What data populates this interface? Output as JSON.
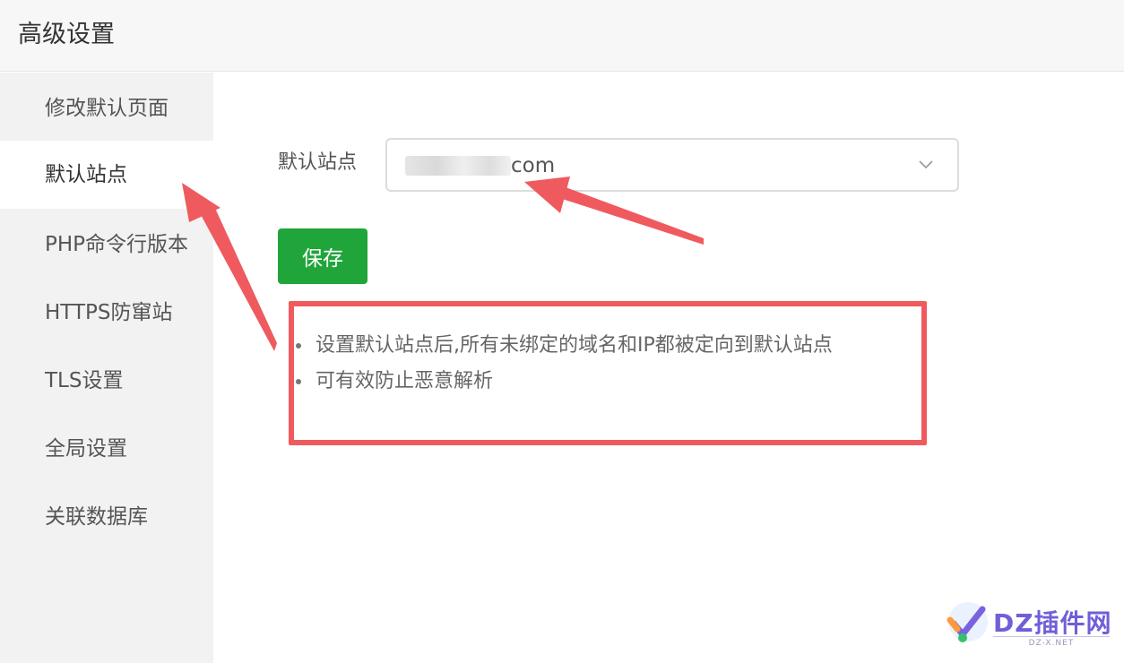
{
  "header": {
    "title": "高级设置"
  },
  "sidebar": {
    "items": [
      {
        "label": "修改默认页面"
      },
      {
        "label": "默认站点"
      },
      {
        "label": "PHP命令行版本"
      },
      {
        "label": "HTTPS防窜站"
      },
      {
        "label": "TLS设置"
      },
      {
        "label": "全局设置"
      },
      {
        "label": "关联数据库"
      }
    ],
    "active": "默认站点"
  },
  "main": {
    "default_site_label": "默认站点",
    "default_site_value": "com",
    "save_label": "保存",
    "tips": [
      "设置默认站点后,所有未绑定的域名和IP都被定向到默认站点",
      "可有效防止恶意解析"
    ]
  },
  "watermark": {
    "brand": "DZ插件网",
    "domain": "DZ-X.NET"
  },
  "icons": {
    "select_toggle": "chevron-down-icon"
  },
  "colors": {
    "accent_green": "#20a53a",
    "annotation_red": "#ef5a5f",
    "sidebar_bg": "#f2f2f2",
    "header_bg": "#f7f7f7"
  }
}
